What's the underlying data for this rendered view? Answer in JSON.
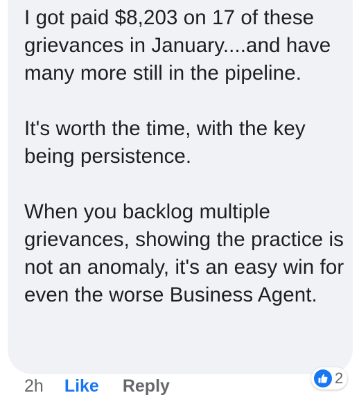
{
  "comment": {
    "paragraphs": [
      "I got paid $8,203 on 17 of these grievances in January....and have many more still in the pipeline.",
      "It's worth the time, with the key being persistence.",
      "When you backlog multiple grievances, showing the practice is not an anomaly, it's an easy win for even the worse Business Agent."
    ]
  },
  "actions": {
    "time": "2h",
    "like_label": "Like",
    "reply_label": "Reply"
  },
  "reactions": {
    "icon": "thumbs-up-icon",
    "count": "2"
  },
  "colors": {
    "bubble": "#f0f2f5",
    "text": "#1c1e21",
    "accent": "#1877f2",
    "muted": "#65676b"
  }
}
